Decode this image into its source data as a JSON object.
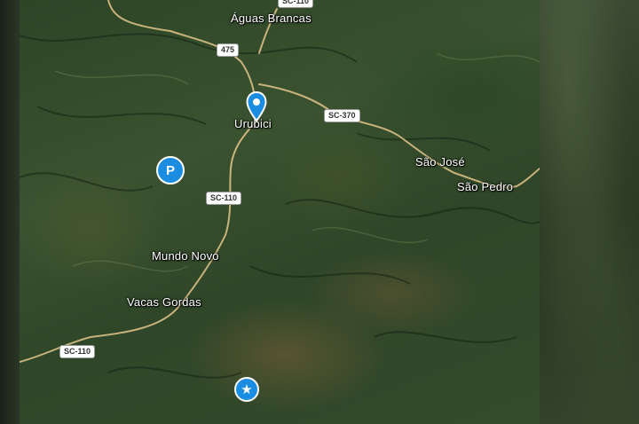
{
  "places": {
    "aguas_brancas": "Águas Brancas",
    "urubici": "Urubici",
    "sao_jose": "São José",
    "sao_pedro": "São Pedro",
    "mundo_novo": "Mundo Novo",
    "vacas_gordas": "Vacas Gordas"
  },
  "roads": {
    "br475": "475",
    "sc370": "SC-370",
    "sc110_north": "SC-110",
    "sc110_south": "SC-110",
    "top_partial": "SC-110"
  },
  "markers": {
    "parking": "P",
    "star": "★"
  },
  "icons": {
    "location_pin": "map-pin-icon",
    "parking": "parking-icon",
    "star": "star-icon"
  },
  "colors": {
    "marker_blue": "#1a8de3",
    "road": "#e3c58a"
  }
}
